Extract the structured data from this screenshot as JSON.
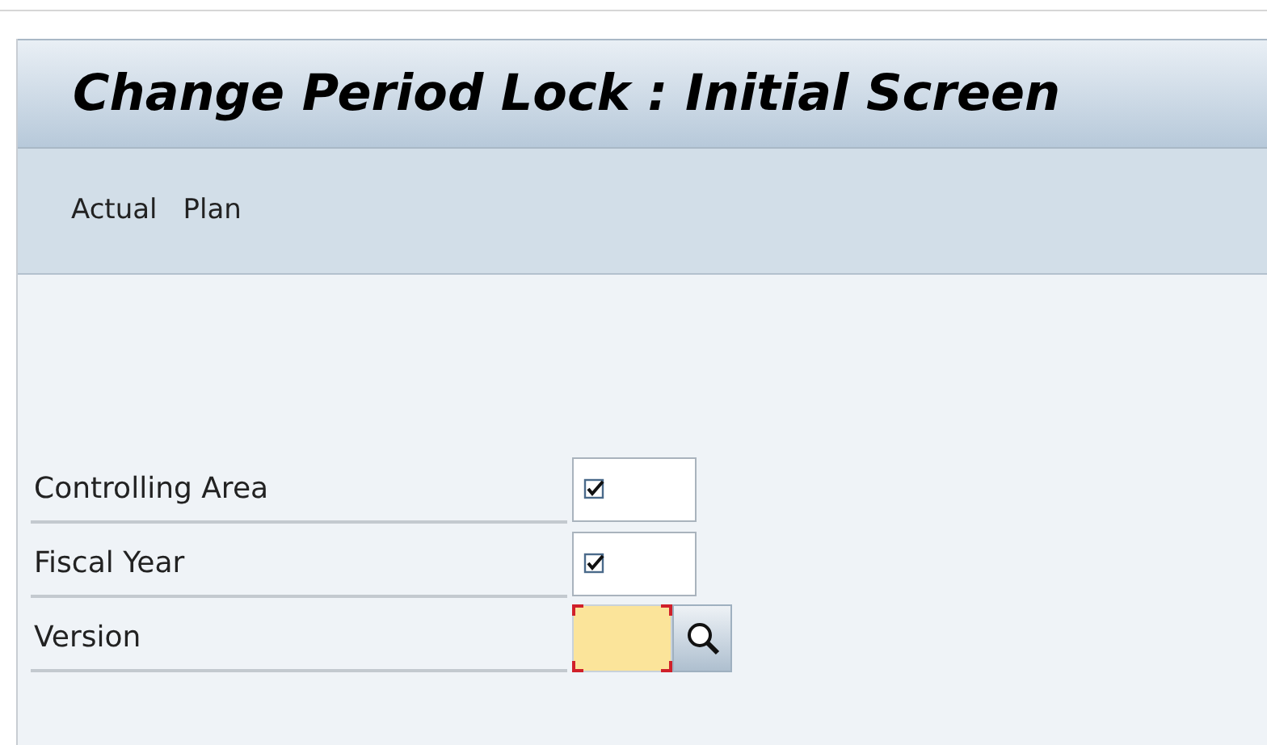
{
  "title": "Change Period Lock : Initial Screen",
  "toolbar": [
    "Actual",
    "Plan"
  ],
  "fields": [
    {
      "label": "Controlling Area",
      "kind": "checkbox",
      "checked": true
    },
    {
      "label": "Fiscal Year",
      "kind": "checkbox",
      "checked": true
    },
    {
      "label": "Version",
      "kind": "input",
      "required": true
    }
  ]
}
